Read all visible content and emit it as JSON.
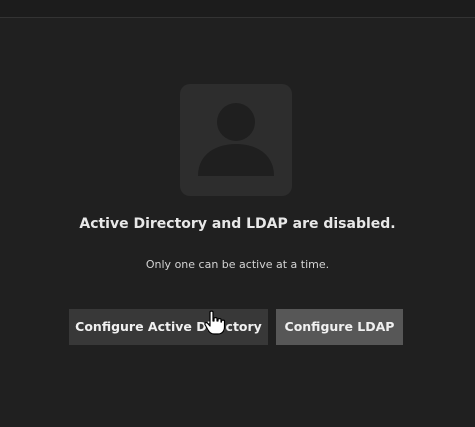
{
  "empty_state": {
    "icon": "user-placeholder-icon",
    "title": "Active Directory and LDAP are disabled.",
    "subtitle": "Only one can be active at a time."
  },
  "actions": {
    "configure_ad_label": "Configure Active Directory",
    "configure_ldap_label": "Configure LDAP"
  },
  "cursor": {
    "type": "hand-pointer-icon"
  },
  "colors": {
    "background": "#202020",
    "avatar_bg": "#2d2d2d",
    "avatar_fg": "#1f1f1f",
    "button_dark": "#383838",
    "button_light": "#575757",
    "text": "#e8e8e8"
  }
}
